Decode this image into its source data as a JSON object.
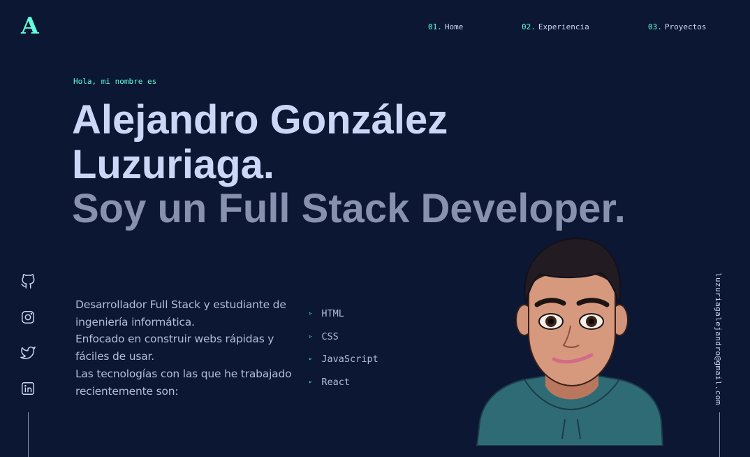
{
  "logo": {
    "letter": "A"
  },
  "nav": [
    {
      "num": "01.",
      "label": "Home"
    },
    {
      "num": "02.",
      "label": "Experiencia"
    },
    {
      "num": "03.",
      "label": "Proyectos"
    }
  ],
  "hero": {
    "greeting": "Hola, mi nombre es",
    "name": "Alejandro González Luzuriaga.",
    "role": "Soy un Full Stack Developer.",
    "bio": [
      "Desarrollador Full Stack y estudiante de ingeniería informática.",
      "Enfocado en construir webs rápidas y fáciles de usar.",
      "Las tecnologías con las que he trabajado recientemente son:"
    ],
    "technologies": [
      "HTML",
      "CSS",
      "JavaScript",
      "React"
    ]
  },
  "socials": [
    {
      "icon": "github-icon"
    },
    {
      "icon": "instagram-icon"
    },
    {
      "icon": "twitter-icon"
    },
    {
      "icon": "linkedin-icon"
    }
  ],
  "email": "luzuriagalejandro@gmail.com",
  "colors": {
    "background": "#0b1733",
    "accent": "#64ffda",
    "heading": "#ccd6f6",
    "muted": "#8892b0"
  },
  "icons": {
    "tech_bullet": "triangle-right-icon"
  }
}
